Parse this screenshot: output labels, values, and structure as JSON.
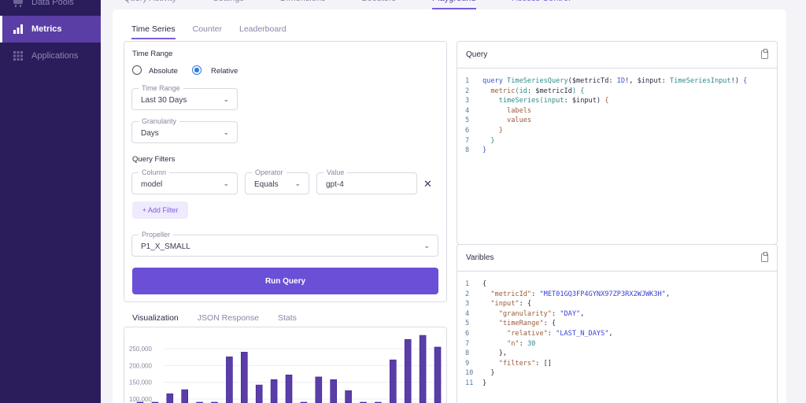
{
  "sidebar": {
    "items": [
      {
        "label": "Data Pools"
      },
      {
        "label": "Metrics",
        "active": true
      },
      {
        "label": "Applications"
      }
    ]
  },
  "top_tabs": [
    "Query Activity",
    "Settings",
    "Dimensions",
    "Boosters",
    "Playground",
    "Access Control"
  ],
  "sub_tabs": [
    "Time Series",
    "Counter",
    "Leaderboard"
  ],
  "form": {
    "time_range_heading": "Time Range",
    "radio_absolute": "Absolute",
    "radio_relative": "Relative",
    "selected": "Relative",
    "time_range": {
      "label": "Time Range",
      "value": "Last 30 Days"
    },
    "granularity": {
      "label": "Granularity",
      "value": "Days"
    },
    "filters_heading": "Query Filters",
    "column": {
      "label": "Column",
      "value": "model"
    },
    "operator": {
      "label": "Operator",
      "value": "Equals"
    },
    "value": {
      "label": "Value",
      "value": "gpt-4"
    },
    "add_filter": "+ Add Filter",
    "propeller": {
      "label": "Propeller",
      "value": "P1_X_SMALL"
    },
    "run": "Run Query"
  },
  "query_panel": {
    "title": "Query",
    "lines": [
      [
        [
          "k",
          "query "
        ],
        [
          "t",
          "TimeSeriesQuery"
        ],
        [
          "v",
          "($metricTd: "
        ],
        [
          "k",
          "ID"
        ],
        [
          "v",
          "!, $input: "
        ],
        [
          "t",
          "TimeSeriesInput"
        ],
        [
          "v",
          "!) "
        ],
        [
          "k",
          "{"
        ]
      ],
      [
        [
          "p",
          "  "
        ],
        [
          "f",
          "metric"
        ],
        [
          "t",
          "("
        ],
        [
          "t",
          "id"
        ],
        [
          "v",
          ": $metricId"
        ],
        [
          "t",
          ") {"
        ]
      ],
      [
        [
          "p",
          "    "
        ],
        [
          "t",
          "timeSeries"
        ],
        [
          "t",
          "(input"
        ],
        [
          "v",
          ": $input) "
        ],
        [
          "f",
          "{"
        ]
      ],
      [
        [
          "p",
          "      "
        ],
        [
          "f",
          "labels"
        ]
      ],
      [
        [
          "p",
          "      "
        ],
        [
          "f",
          "values"
        ]
      ],
      [
        [
          "p",
          "    "
        ],
        [
          "f",
          "}"
        ]
      ],
      [
        [
          "p",
          "  "
        ],
        [
          "t",
          "}"
        ]
      ],
      [
        [
          "k",
          "}"
        ]
      ]
    ]
  },
  "variables_panel": {
    "title": "Varibles",
    "lines": [
      [
        [
          "v",
          "{"
        ]
      ],
      [
        [
          "p",
          "  "
        ],
        [
          "f",
          "\"metricId\""
        ],
        [
          "v",
          ": "
        ],
        [
          "s",
          "\"MET01GQ3FP4GYNX97ZP3RX2WJWK3H\""
        ],
        [
          "v",
          ","
        ]
      ],
      [
        [
          "p",
          "  "
        ],
        [
          "f",
          "\"input\""
        ],
        [
          "v",
          ": {"
        ]
      ],
      [
        [
          "p",
          "    "
        ],
        [
          "f",
          "\"granularity\""
        ],
        [
          "v",
          ": "
        ],
        [
          "s",
          "\"DAY\""
        ],
        [
          "v",
          ","
        ]
      ],
      [
        [
          "p",
          "    "
        ],
        [
          "f",
          "\"timeRange\""
        ],
        [
          "v",
          ": {"
        ]
      ],
      [
        [
          "p",
          "      "
        ],
        [
          "f",
          "\"relative\""
        ],
        [
          "v",
          ": "
        ],
        [
          "s",
          "\"LAST_N_DAYS\""
        ],
        [
          "v",
          ","
        ]
      ],
      [
        [
          "p",
          "      "
        ],
        [
          "f",
          "\"n\""
        ],
        [
          "v",
          ": "
        ],
        [
          "n",
          "30"
        ]
      ],
      [
        [
          "p",
          "    "
        ],
        [
          "v",
          "},"
        ]
      ],
      [
        [
          "p",
          "    "
        ],
        [
          "f",
          "\"filters\""
        ],
        [
          "v",
          ": []"
        ]
      ],
      [
        [
          "p",
          "  "
        ],
        [
          "v",
          "}"
        ]
      ],
      [
        [
          "v",
          "}"
        ]
      ]
    ]
  },
  "viz_tabs": [
    "Visualization",
    "JSON Response",
    "Stats"
  ],
  "colors": {
    "accent": "#6b4fd6",
    "bar": "#5a3ea6",
    "sidebar": "#2b1d5c"
  },
  "chart_data": {
    "type": "bar",
    "title": "",
    "xlabel": "",
    "ylabel": "",
    "yticks": [
      "250,000",
      "200,000",
      "150,000",
      "100,000"
    ],
    "ytick_values": [
      250000,
      200000,
      150000,
      100000
    ],
    "ylim": [
      0,
      300000
    ],
    "values": [
      70000,
      70000,
      116000,
      128000,
      70000,
      70000,
      226000,
      240000,
      142000,
      158000,
      172000,
      70000,
      166000,
      158000,
      125000,
      70000,
      70000,
      217000,
      278000,
      290000,
      255000
    ]
  }
}
